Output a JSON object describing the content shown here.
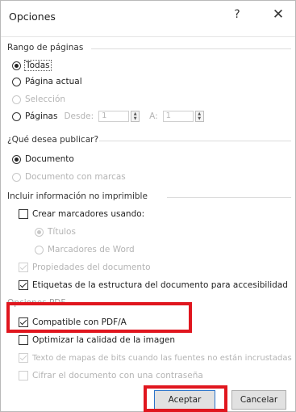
{
  "window": {
    "title": "Opciones",
    "help_glyph": "?",
    "close_glyph": "✕"
  },
  "page_range": {
    "title": "Rango de páginas",
    "all": "Todas",
    "current": "Página actual",
    "selection": "Selección",
    "pages": "Páginas",
    "from_label": "Desde:",
    "from_value": "1",
    "to_label": "A:",
    "to_value": "1"
  },
  "publish": {
    "title": "¿Qué desea publicar?",
    "document": "Documento",
    "document_markup": "Documento con marcas"
  },
  "nonprint": {
    "title": "Incluir información no imprimible",
    "create_bookmarks": "Crear marcadores usando:",
    "headings": "Títulos",
    "word_bookmarks": "Marcadores de Word",
    "doc_properties": "Propiedades del documento",
    "structure_tags": "Etiquetas de la estructura del documento para accesibilidad"
  },
  "pdf_options": {
    "title": "Opciones PDF",
    "pdfa": "Compatible con PDF/A",
    "optimize": "Optimizar la calidad de la imagen",
    "bitmap_text": "Texto de mapas de bits cuando las fuentes no están incrustadas",
    "encrypt": "Cifrar el documento con una contraseña"
  },
  "buttons": {
    "accept": "Aceptar",
    "cancel": "Cancelar"
  },
  "colors": {
    "highlight": "#e0161e",
    "default_button_border": "#2a73c9"
  }
}
